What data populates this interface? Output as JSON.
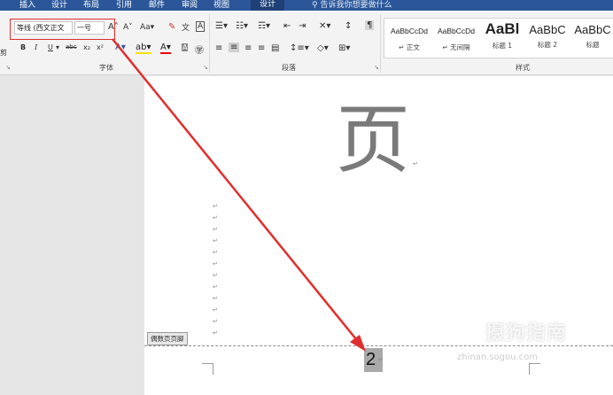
{
  "tabs": [
    {
      "label": "插入",
      "active": false
    },
    {
      "label": "设计",
      "active": false
    },
    {
      "label": "布局",
      "active": false
    },
    {
      "label": "引用",
      "active": false
    },
    {
      "label": "邮件",
      "active": false
    },
    {
      "label": "审阅",
      "active": false
    },
    {
      "label": "视图",
      "active": false
    },
    {
      "label": "设计",
      "active": true
    }
  ],
  "tell_me": "告诉我你想要做什么",
  "font": {
    "name_value": "等线 (西文正文",
    "size_value": "一号",
    "bold": "B",
    "italic": "I",
    "underline": "U",
    "strike": "abc",
    "subscript": "x₂",
    "superscript": "x²",
    "case": "Aa",
    "group_label": "字体"
  },
  "paragraph": {
    "group_label": "段落"
  },
  "styles": {
    "group_label": "样式",
    "items": [
      {
        "preview": "AaBbCcDd",
        "name": "↵ 正文"
      },
      {
        "preview": "AaBbCcDd",
        "name": "↵ 无间隔"
      },
      {
        "preview": "AaBl",
        "name": "标题 1"
      },
      {
        "preview": "AaBbC",
        "name": "标题 2"
      },
      {
        "preview": "AaBbC",
        "name": "标题"
      }
    ]
  },
  "left_fragment": "剪",
  "document": {
    "heading_char": "页",
    "footer_tag": "偶数页页脚",
    "page_number": "2",
    "return_mark": "↵"
  },
  "watermark": {
    "text": "摄狗指南",
    "url": "zhinan.sogou.com"
  },
  "colors": {
    "tabbar": "#2b579a",
    "annotation": "#e02e2e"
  }
}
